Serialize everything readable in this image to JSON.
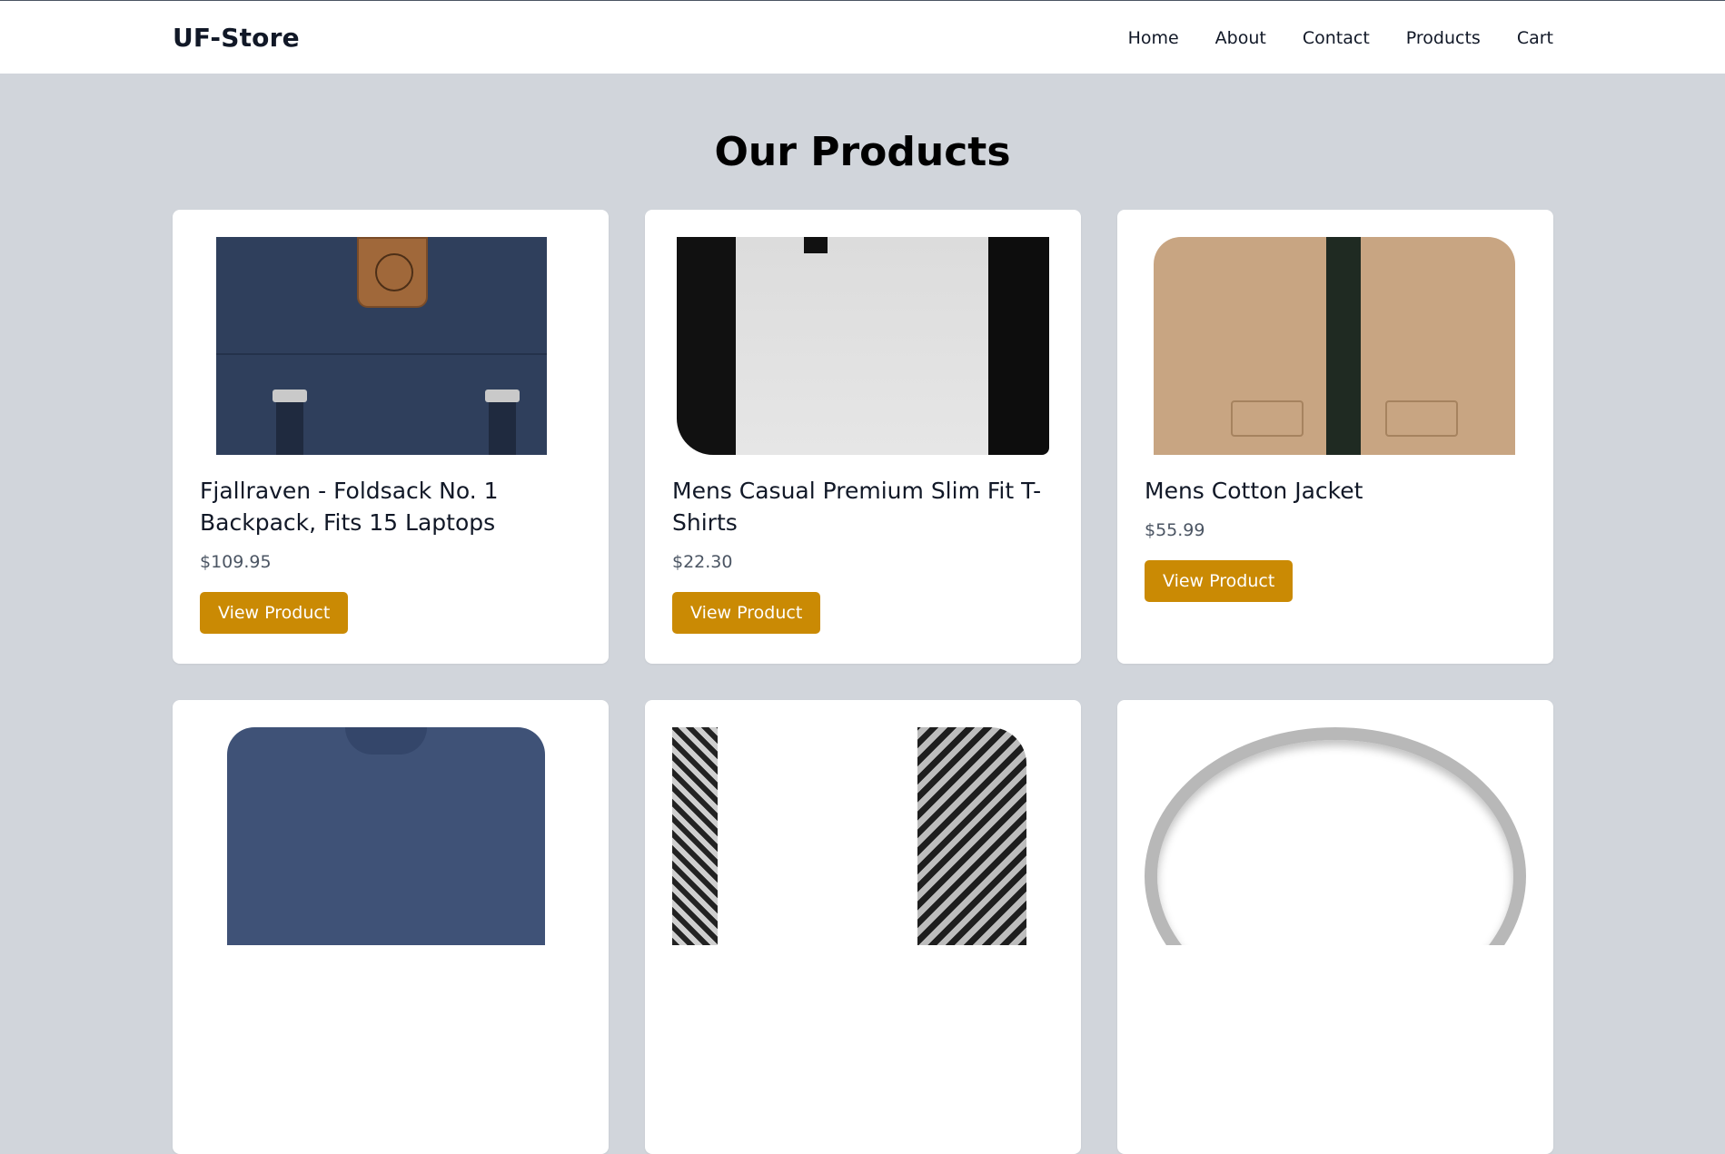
{
  "header": {
    "brand": "UF-Store",
    "nav": [
      {
        "label": "Home"
      },
      {
        "label": "About"
      },
      {
        "label": "Contact"
      },
      {
        "label": "Products"
      },
      {
        "label": "Cart"
      }
    ]
  },
  "main": {
    "title": "Our Products",
    "products": [
      {
        "title": "Fjallraven - Foldsack No. 1 Backpack, Fits 15 Laptops",
        "price": "$109.95",
        "button": "View Product",
        "image": "backpack"
      },
      {
        "title": "Mens Casual Premium Slim Fit T-Shirts",
        "price": "$22.30",
        "button": "View Product",
        "image": "t-shirt"
      },
      {
        "title": "Mens Cotton Jacket",
        "price": "$55.99",
        "button": "View Product",
        "image": "jacket"
      },
      {
        "image": "blue-shirt"
      },
      {
        "image": "chain-bracelet"
      },
      {
        "image": "silver-ring"
      }
    ]
  },
  "colors": {
    "background": "#d1d5db",
    "accent": "#ca8a04",
    "card": "#ffffff"
  }
}
